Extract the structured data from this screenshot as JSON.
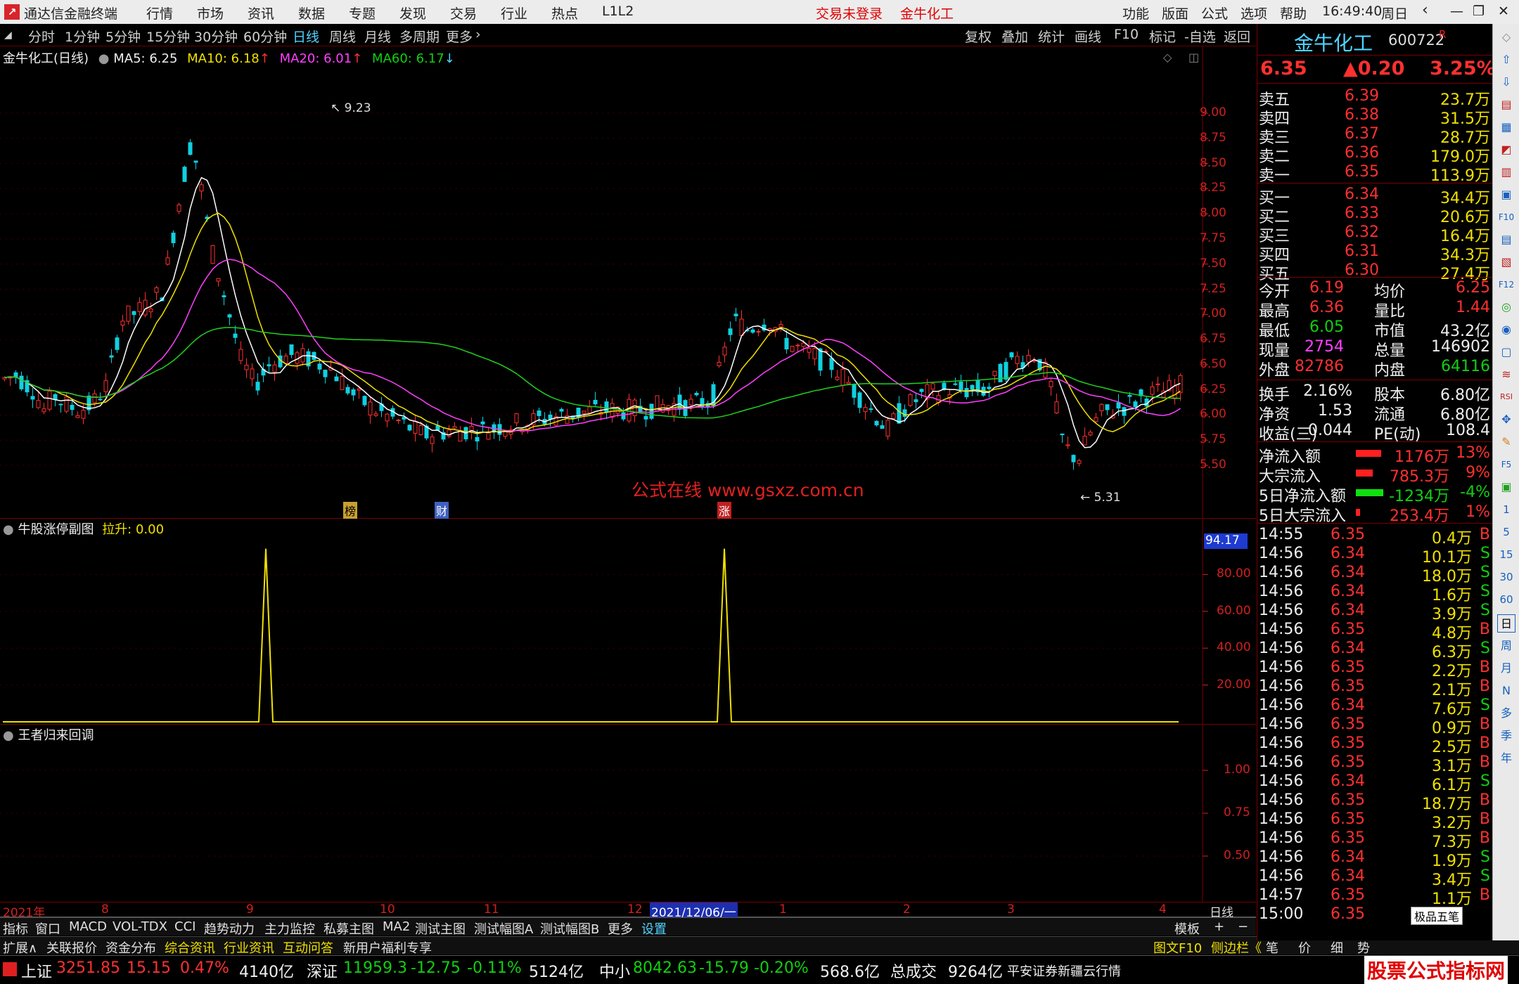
{
  "titlebar": {
    "app_title": "通达信金融终端",
    "menus": [
      "行情",
      "市场",
      "资讯",
      "数据",
      "专题",
      "发现",
      "交易",
      "行业",
      "热点",
      "L1L2"
    ],
    "login_status": "交易未登录",
    "stock_title": "金牛化工",
    "right_menus": [
      "功能",
      "版面",
      "公式",
      "选项",
      "帮助"
    ],
    "time": "16:49:40",
    "weekday": "周日"
  },
  "periods": [
    "分时",
    "1分钟",
    "5分钟",
    "15分钟",
    "30分钟",
    "60分钟",
    "日线",
    "周线",
    "月线",
    "多周期",
    "更多"
  ],
  "active_period": "日线",
  "chart_toolbar": [
    "复权",
    "叠加",
    "统计",
    "画线",
    "F10",
    "标记",
    "-自选",
    "返回"
  ],
  "main_chart": {
    "name": "金牛化工(日线)",
    "ma5": "MA5: 6.25",
    "ma10": "MA10: 6.18",
    "ma20": "MA20: 6.01",
    "ma60": "MA60: 6.17",
    "high_label": "9.23",
    "low_label": "5.31",
    "y_ticks": [
      "9.00",
      "8.75",
      "8.50",
      "8.25",
      "8.00",
      "7.75",
      "7.50",
      "7.25",
      "7.00",
      "6.75",
      "6.50",
      "6.25",
      "6.00",
      "5.75",
      "5.50"
    ],
    "watermark": "公式在线  www.gsxz.com.cn",
    "markers": [
      "榜",
      "财",
      "涨"
    ]
  },
  "sub_chart1": {
    "name": "牛股涨停副图",
    "value_label": "拉升: 0.00",
    "top_value": "94.17",
    "y_ticks": [
      "80.00",
      "60.00",
      "40.00",
      "20.00"
    ]
  },
  "sub_chart2": {
    "name": "王者归来回调",
    "y_ticks": [
      "1.00",
      "0.75",
      "0.50"
    ]
  },
  "time_axis": {
    "labels": [
      "2021年",
      "8",
      "9",
      "10",
      "11",
      "12",
      "2021/12/06/一",
      "1",
      "2",
      "3",
      "4"
    ],
    "period_label": "日线"
  },
  "indicator_tabs": [
    "指标",
    "窗口",
    "MACD",
    "VOL-TDX",
    "CCI",
    "趋势动力",
    "主力监控",
    "私募主图",
    "MA2",
    "测试主图",
    "测试幅图A",
    "测试幅图B",
    "更多",
    "设置"
  ],
  "indicator_right": [
    "模板",
    "+",
    "−"
  ],
  "info_tabs": [
    "扩展∧",
    "关联报价",
    "资金分布",
    "综合资讯",
    "行业资讯",
    "互动问答",
    "新用户福利专享"
  ],
  "info_right": [
    "图文F10",
    "侧边栏《",
    "笔",
    "价",
    "细",
    "势"
  ],
  "quote": {
    "name": "金牛化工",
    "code": "600722",
    "flag": "R",
    "price": "6.35",
    "change": "▲0.20",
    "pct": "3.25%",
    "asks": [
      {
        "label": "卖五",
        "price": "6.39",
        "vol": "23.7万"
      },
      {
        "label": "卖四",
        "price": "6.38",
        "vol": "31.5万"
      },
      {
        "label": "卖三",
        "price": "6.37",
        "vol": "28.7万"
      },
      {
        "label": "卖二",
        "price": "6.36",
        "vol": "179.0万"
      },
      {
        "label": "卖一",
        "price": "6.35",
        "vol": "113.9万"
      }
    ],
    "bids": [
      {
        "label": "买一",
        "price": "6.34",
        "vol": "34.4万"
      },
      {
        "label": "买二",
        "price": "6.33",
        "vol": "20.6万"
      },
      {
        "label": "买三",
        "price": "6.32",
        "vol": "16.4万"
      },
      {
        "label": "买四",
        "price": "6.31",
        "vol": "34.3万"
      },
      {
        "label": "买五",
        "price": "6.30",
        "vol": "27.4万"
      }
    ],
    "stats": [
      {
        "l1": "今开",
        "v1": "6.19",
        "l2": "均价",
        "v2": "6.25",
        "c1": "red",
        "c2": "red"
      },
      {
        "l1": "最高",
        "v1": "6.36",
        "l2": "量比",
        "v2": "1.44",
        "c1": "red",
        "c2": "red"
      },
      {
        "l1": "最低",
        "v1": "6.05",
        "l2": "市值",
        "v2": "43.2亿",
        "c1": "green",
        "c2": "white"
      },
      {
        "l1": "现量",
        "v1": "2754",
        "l2": "总量",
        "v2": "146902",
        "c1": "magenta",
        "c2": "white"
      },
      {
        "l1": "外盘",
        "v1": "82786",
        "l2": "内盘",
        "v2": "64116",
        "c1": "red",
        "c2": "green"
      }
    ],
    "stats2": [
      {
        "l1": "换手",
        "v1": "2.16%",
        "l2": "股本",
        "v2": "6.80亿"
      },
      {
        "l1": "净资",
        "v1": "1.53",
        "l2": "流通",
        "v2": "6.80亿"
      },
      {
        "l1": "收益(三)",
        "v1": "0.044",
        "l2": "PE(动)",
        "v2": "108.4"
      }
    ],
    "flows": [
      {
        "label": "净流入额",
        "value": "1176万",
        "pct": "13%",
        "color": "red",
        "bar": 0.6
      },
      {
        "label": "大宗流入",
        "value": "785.3万",
        "pct": "9%",
        "color": "red",
        "bar": 0.4
      },
      {
        "label": "5日净流入额",
        "value": "-1234万",
        "pct": "-4%",
        "color": "green",
        "bar": 0.65
      },
      {
        "label": "5日大宗流入",
        "value": "253.4万",
        "pct": "1%",
        "color": "red",
        "bar": 0.1
      }
    ],
    "ticks": [
      {
        "t": "14:55",
        "p": "6.35",
        "v": "0.4万",
        "s": "B"
      },
      {
        "t": "14:56",
        "p": "6.34",
        "v": "10.1万",
        "s": "S"
      },
      {
        "t": "14:56",
        "p": "6.34",
        "v": "18.0万",
        "s": "S"
      },
      {
        "t": "14:56",
        "p": "6.34",
        "v": "1.6万",
        "s": "S"
      },
      {
        "t": "14:56",
        "p": "6.34",
        "v": "3.9万",
        "s": "S"
      },
      {
        "t": "14:56",
        "p": "6.35",
        "v": "4.8万",
        "s": "B"
      },
      {
        "t": "14:56",
        "p": "6.34",
        "v": "6.3万",
        "s": "S"
      },
      {
        "t": "14:56",
        "p": "6.35",
        "v": "2.2万",
        "s": "B"
      },
      {
        "t": "14:56",
        "p": "6.35",
        "v": "2.1万",
        "s": "B"
      },
      {
        "t": "14:56",
        "p": "6.34",
        "v": "7.6万",
        "s": "S"
      },
      {
        "t": "14:56",
        "p": "6.35",
        "v": "0.9万",
        "s": "B"
      },
      {
        "t": "14:56",
        "p": "6.35",
        "v": "2.5万",
        "s": "B"
      },
      {
        "t": "14:56",
        "p": "6.35",
        "v": "3.1万",
        "s": "B"
      },
      {
        "t": "14:56",
        "p": "6.34",
        "v": "6.1万",
        "s": "S"
      },
      {
        "t": "14:56",
        "p": "6.35",
        "v": "18.7万",
        "s": "B"
      },
      {
        "t": "14:56",
        "p": "6.35",
        "v": "3.2万",
        "s": "B"
      },
      {
        "t": "14:56",
        "p": "6.35",
        "v": "7.3万",
        "s": "B"
      },
      {
        "t": "14:56",
        "p": "6.34",
        "v": "1.9万",
        "s": "S"
      },
      {
        "t": "14:56",
        "p": "6.34",
        "v": "3.4万",
        "s": "S"
      },
      {
        "t": "14:57",
        "p": "6.35",
        "v": "1.1万",
        "s": "B"
      },
      {
        "t": "15:00",
        "p": "6.35",
        "v": "",
        "s": ""
      }
    ],
    "ticks_overlay": "极品五笔"
  },
  "sidebar": [
    "日",
    "周",
    "月",
    "N",
    "多",
    "季",
    "年",
    "1",
    "5",
    "15",
    "30",
    "60"
  ],
  "statusbar": {
    "items": [
      {
        "name": "上证",
        "value": "3251.85",
        "chg": "15.15",
        "pct": "0.47%",
        "amt": "4140亿",
        "up": true
      },
      {
        "name": "深证",
        "value": "11959.3",
        "chg": "-12.75",
        "pct": "-0.11%",
        "amt": "5124亿",
        "up": false
      },
      {
        "name": "中小",
        "value": "8042.63",
        "chg": "-15.79",
        "pct": "-0.20%",
        "amt": "568.6亿",
        "up": false
      }
    ],
    "total_label": "总成交",
    "total_value": "9264亿",
    "broker": "平安证券新疆云行情",
    "logo_text": "股票公式指标网",
    "logo_url": "www.gszx.com.cn"
  },
  "colors": {
    "up": "#ff3030",
    "down": "#10d0e0",
    "ma5": "#ffffff",
    "ma10": "#f0e000",
    "ma20": "#ff40ff",
    "ma60": "#20d020"
  }
}
